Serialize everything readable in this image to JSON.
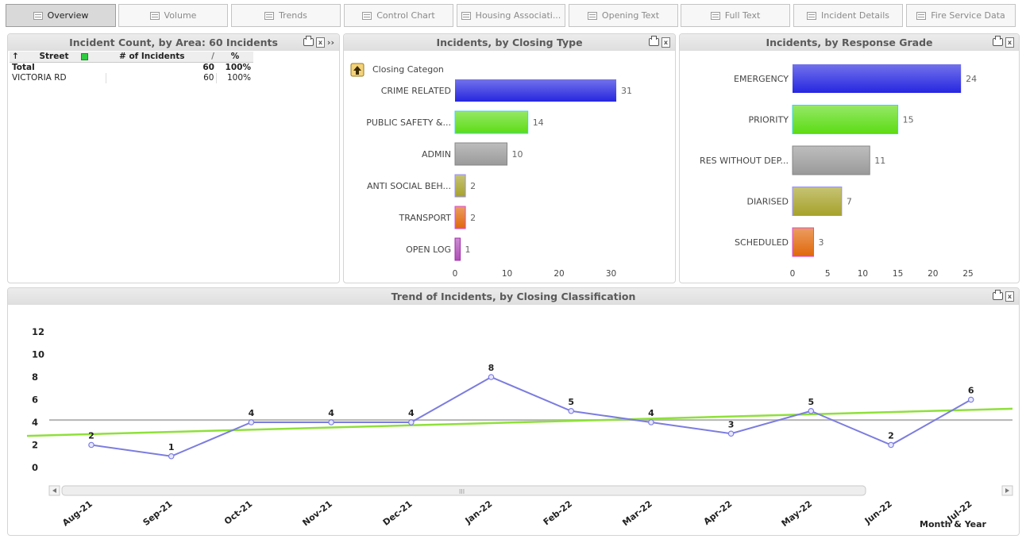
{
  "tabs": [
    {
      "label": "Overview",
      "active": true
    },
    {
      "label": "Volume",
      "active": false
    },
    {
      "label": "Trends",
      "active": false
    },
    {
      "label": "Control Chart",
      "active": false
    },
    {
      "label": "Housing Associati...",
      "active": false
    },
    {
      "label": "Opening Text",
      "active": false
    },
    {
      "label": "Full Text",
      "active": false
    },
    {
      "label": "Incident Details",
      "active": false
    },
    {
      "label": "Fire Service Data",
      "active": false
    }
  ],
  "area_panel": {
    "title": "Incident Count, by Area: 60 Incidents",
    "more_icon": "››",
    "columns": [
      "Street",
      "# of Incidents",
      "%"
    ],
    "total_row": {
      "label": "Total",
      "count": "60",
      "pct": "100%"
    },
    "rows": [
      {
        "street": "VICTORIA RD",
        "count": "60",
        "pct": "100%"
      }
    ]
  },
  "closing_panel": {
    "title": "Incidents, by Closing Type",
    "drill_label": "Closing Categon"
  },
  "response_panel": {
    "title": "Incidents, by Response Grade"
  },
  "trend_panel": {
    "title": "Trend of Incidents, by Closing Classification",
    "scroll_icon": "III"
  },
  "chart_data": [
    {
      "type": "bar",
      "orientation": "horizontal",
      "title": "Incidents, by Closing Type",
      "categories": [
        "CRIME RELATED",
        "PUBLIC SAFETY &...",
        "ADMIN",
        "ANTI SOCIAL BEH...",
        "TRANSPORT",
        "OPEN LOG"
      ],
      "values": [
        31,
        14,
        10,
        2,
        2,
        1
      ],
      "colors": [
        "#2626e0",
        "#5cdc14",
        "#9a9a9a",
        "#a7a22a",
        "#e0680a",
        "#b04fb8"
      ],
      "xticks": [
        0,
        10,
        20,
        30
      ],
      "xlim": [
        0,
        31
      ]
    },
    {
      "type": "bar",
      "orientation": "horizontal",
      "title": "Incidents, by Response Grade",
      "categories": [
        "EMERGENCY",
        "PRIORITY",
        "RES WITHOUT DEP...",
        "DIARISED",
        "SCHEDULED"
      ],
      "values": [
        24,
        15,
        11,
        7,
        3
      ],
      "colors": [
        "#2626e0",
        "#5cdc14",
        "#9a9a9a",
        "#a7a22a",
        "#e0680a"
      ],
      "xticks": [
        0,
        5,
        10,
        15,
        20,
        25
      ],
      "xlim": [
        0,
        25
      ]
    },
    {
      "type": "line",
      "title": "Trend of Incidents, by Closing Classification",
      "xlabel": "Month & Year",
      "categories": [
        "Aug-21",
        "Sep-21",
        "Oct-21",
        "Nov-21",
        "Dec-21",
        "Jan-22",
        "Feb-22",
        "Mar-22",
        "Apr-22",
        "May-22",
        "Jun-22",
        "Jul-22"
      ],
      "series": [
        {
          "values": [
            2,
            1,
            4,
            4,
            4,
            8,
            5,
            4,
            3,
            5,
            2,
            6
          ],
          "color": "#7c7ce0"
        }
      ],
      "average_line": {
        "value": 4.2,
        "color": "#b5b5b5"
      },
      "trend_line": {
        "start": 2.8,
        "end": 5.2,
        "color": "#8fe03a"
      },
      "yticks": [
        0,
        2,
        4,
        6,
        8,
        10,
        12
      ],
      "ylim": [
        0,
        12
      ]
    }
  ]
}
